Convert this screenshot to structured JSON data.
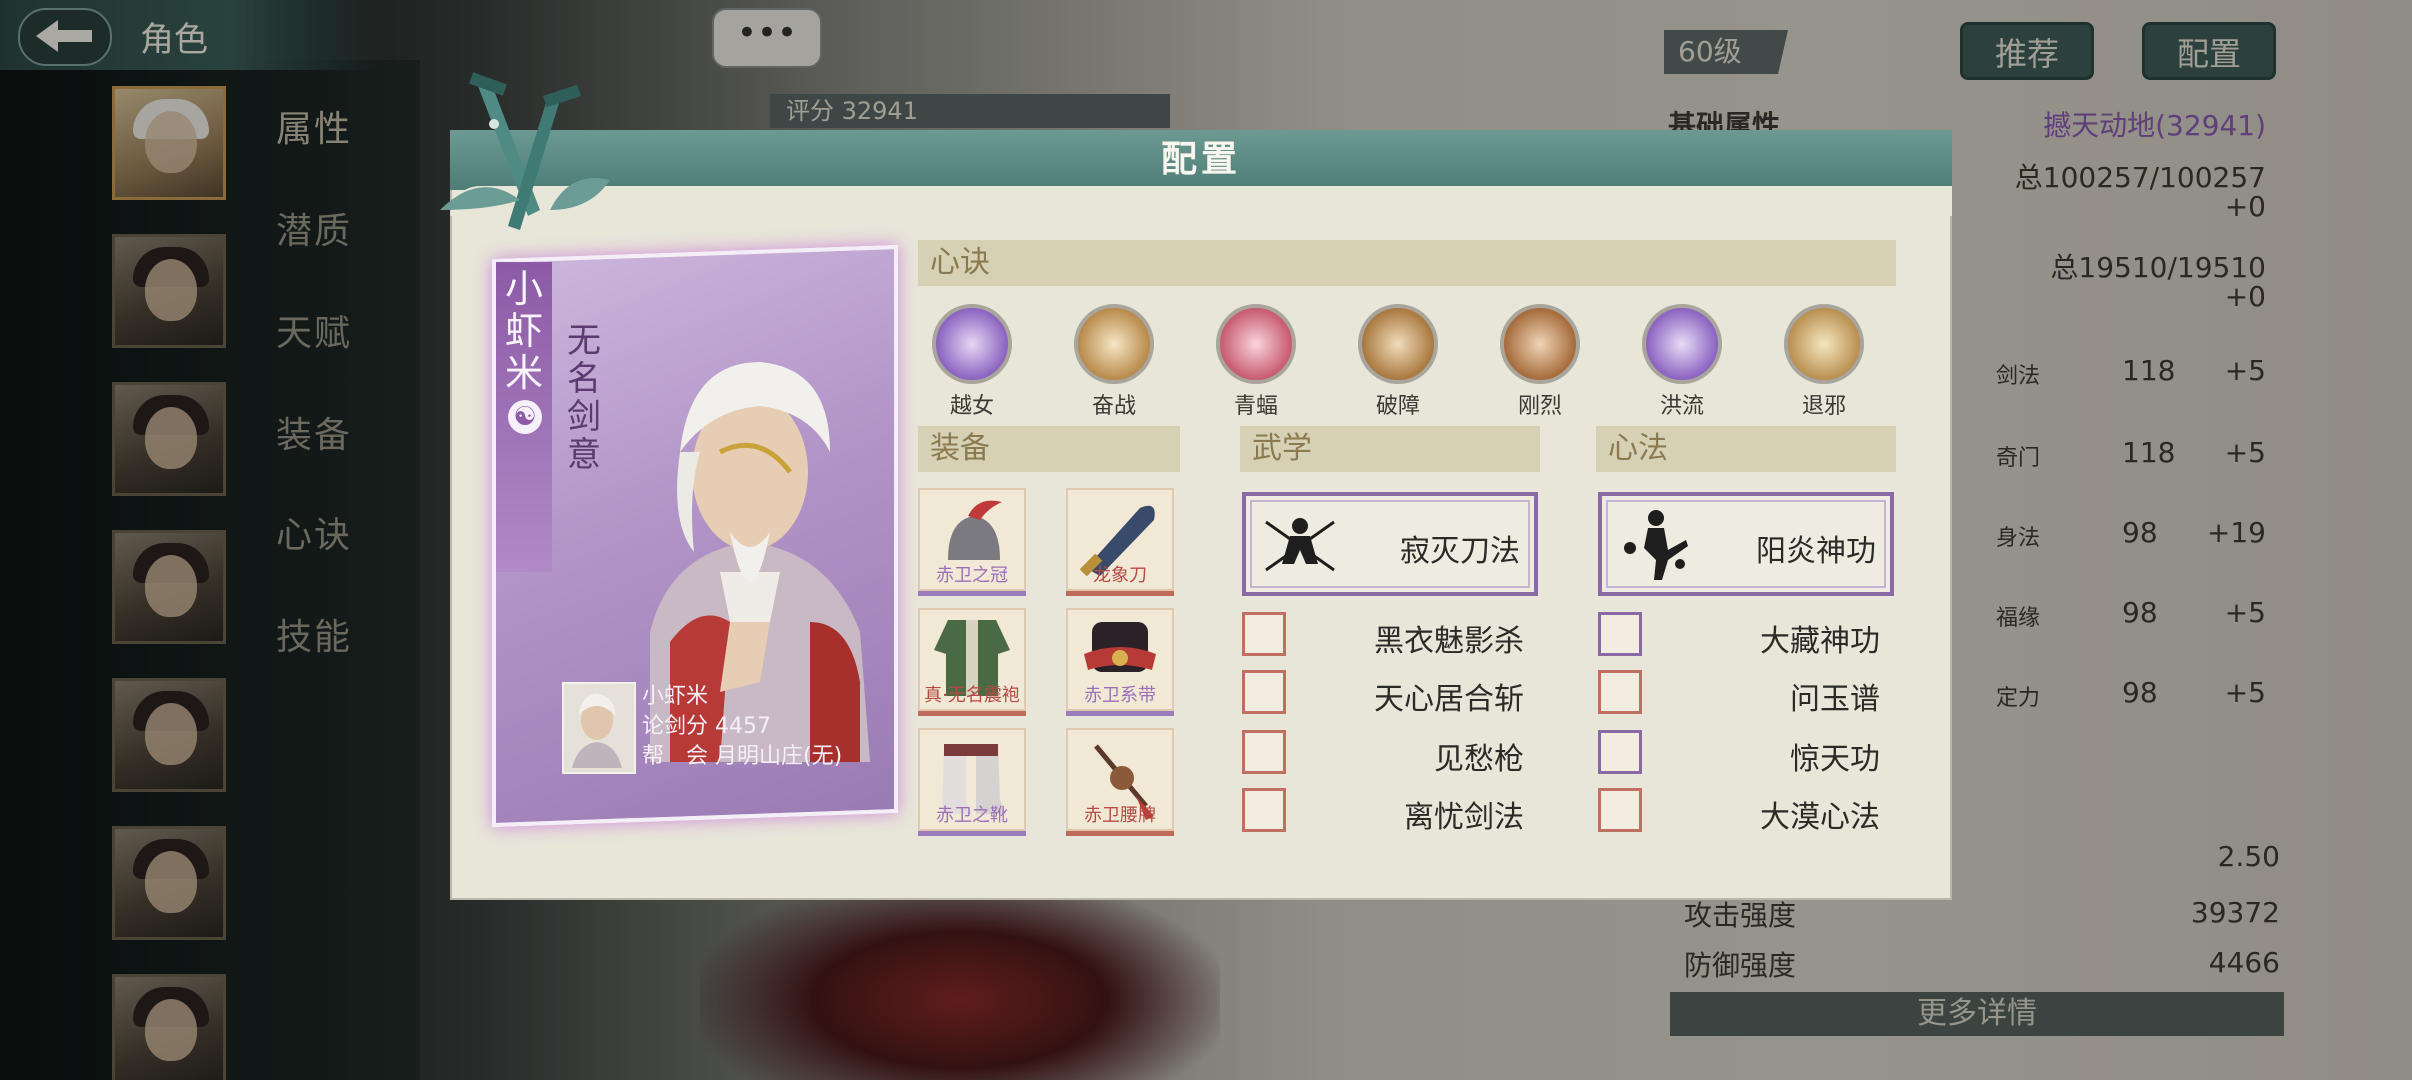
{
  "header": {
    "title": "角色"
  },
  "side_tabs": [
    "属性",
    "潜质",
    "天赋",
    "装备",
    "心诀",
    "技能"
  ],
  "top_buttons": {
    "recommend": "推荐",
    "config": "配置"
  },
  "level": "60级",
  "score": "评分 32941",
  "chat_bubble": "•••",
  "stats": {
    "section_title": "基础属性",
    "rating": "撼天动地(32941)",
    "total1": "总100257/100257",
    "plus1": "+0",
    "total2": "总19510/19510",
    "plus2": "+0",
    "rows": [
      {
        "label": "剑法",
        "val": "118",
        "bonus": "+5"
      },
      {
        "label": "奇门",
        "val": "118",
        "bonus": "+5"
      },
      {
        "label": "身法",
        "val": "98",
        "bonus": "+19"
      },
      {
        "label": "福缘",
        "val": "98",
        "bonus": "+5"
      },
      {
        "label": "定力",
        "val": "98",
        "bonus": "+5"
      }
    ],
    "value_250": "2.50",
    "attack_label": "攻击强度",
    "attack_val": "39372",
    "defense_label": "防御强度",
    "defense_val": "4466",
    "more": "更多详情"
  },
  "dialog": {
    "title": "配置",
    "card": {
      "name_vertical": "小虾米",
      "yinyang": "☯",
      "subtitle_vertical": "无名剑意",
      "player_name": "小虾米",
      "sword_score": "论剑分 4457",
      "guild": "帮　会 月明山庄(无)"
    },
    "xinjue_head": "心诀",
    "xinjue": [
      {
        "name": "越女",
        "color": "#7e5ab8"
      },
      {
        "name": "奋战",
        "color": "#b88a4a"
      },
      {
        "name": "青蝠",
        "color": "#c85a70"
      },
      {
        "name": "破障",
        "color": "#a8783e"
      },
      {
        "name": "刚烈",
        "color": "#a56a3a"
      },
      {
        "name": "洪流",
        "color": "#8a62c0"
      },
      {
        "name": "退邪",
        "color": "#b89050"
      }
    ],
    "equip_head": "装备",
    "equipment": [
      {
        "name": "赤卫之冠",
        "tier": "purple"
      },
      {
        "name": "龙象刀",
        "tier": "red"
      },
      {
        "name": "真·无名震袍",
        "tier": "red"
      },
      {
        "name": "赤卫系带",
        "tier": "purple"
      },
      {
        "name": "赤卫之靴",
        "tier": "purple"
      },
      {
        "name": "赤卫腰牌",
        "tier": "red"
      }
    ],
    "wuxue_head": "武学",
    "wuxue_main": "寂灭刀法",
    "wuxue": [
      "黑衣魅影杀",
      "天心居合斩",
      "见愁枪",
      "离忧剑法"
    ],
    "xinfa_head": "心法",
    "xinfa_main": "阳炎神功",
    "xinfa": [
      "大藏神功",
      "问玉谱",
      "惊天功",
      "大漠心法"
    ]
  }
}
